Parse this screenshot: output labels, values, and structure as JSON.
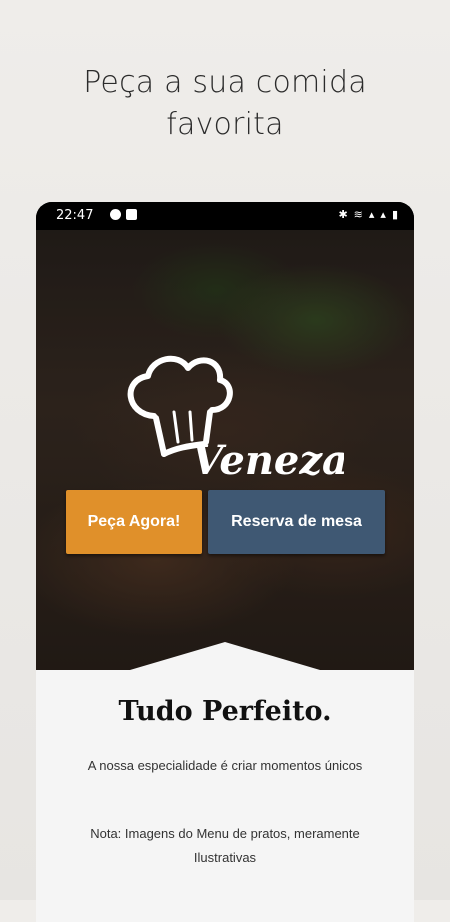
{
  "headline": {
    "line1": "Peça a sua comida",
    "line2": "favorita"
  },
  "status_bar": {
    "time": "22:47"
  },
  "brand": {
    "name": "Veneza"
  },
  "buttons": {
    "order": "Peça Agora!",
    "reserve": "Reserva de mesa"
  },
  "section": {
    "title": "Tudo Perfeito.",
    "subtitle": "A nossa especialidade é criar momentos únicos",
    "note": "Nota: Imagens do Menu de pratos, meramente Ilustrativas"
  },
  "colors": {
    "order_button": "#e0902a",
    "reserve_button": "#3f5873",
    "content_bg": "#f5f5f5"
  },
  "icons": [
    "bluetooth-icon",
    "wifi-icon",
    "signal-icon",
    "battery-icon",
    "chef-hat-icon"
  ]
}
